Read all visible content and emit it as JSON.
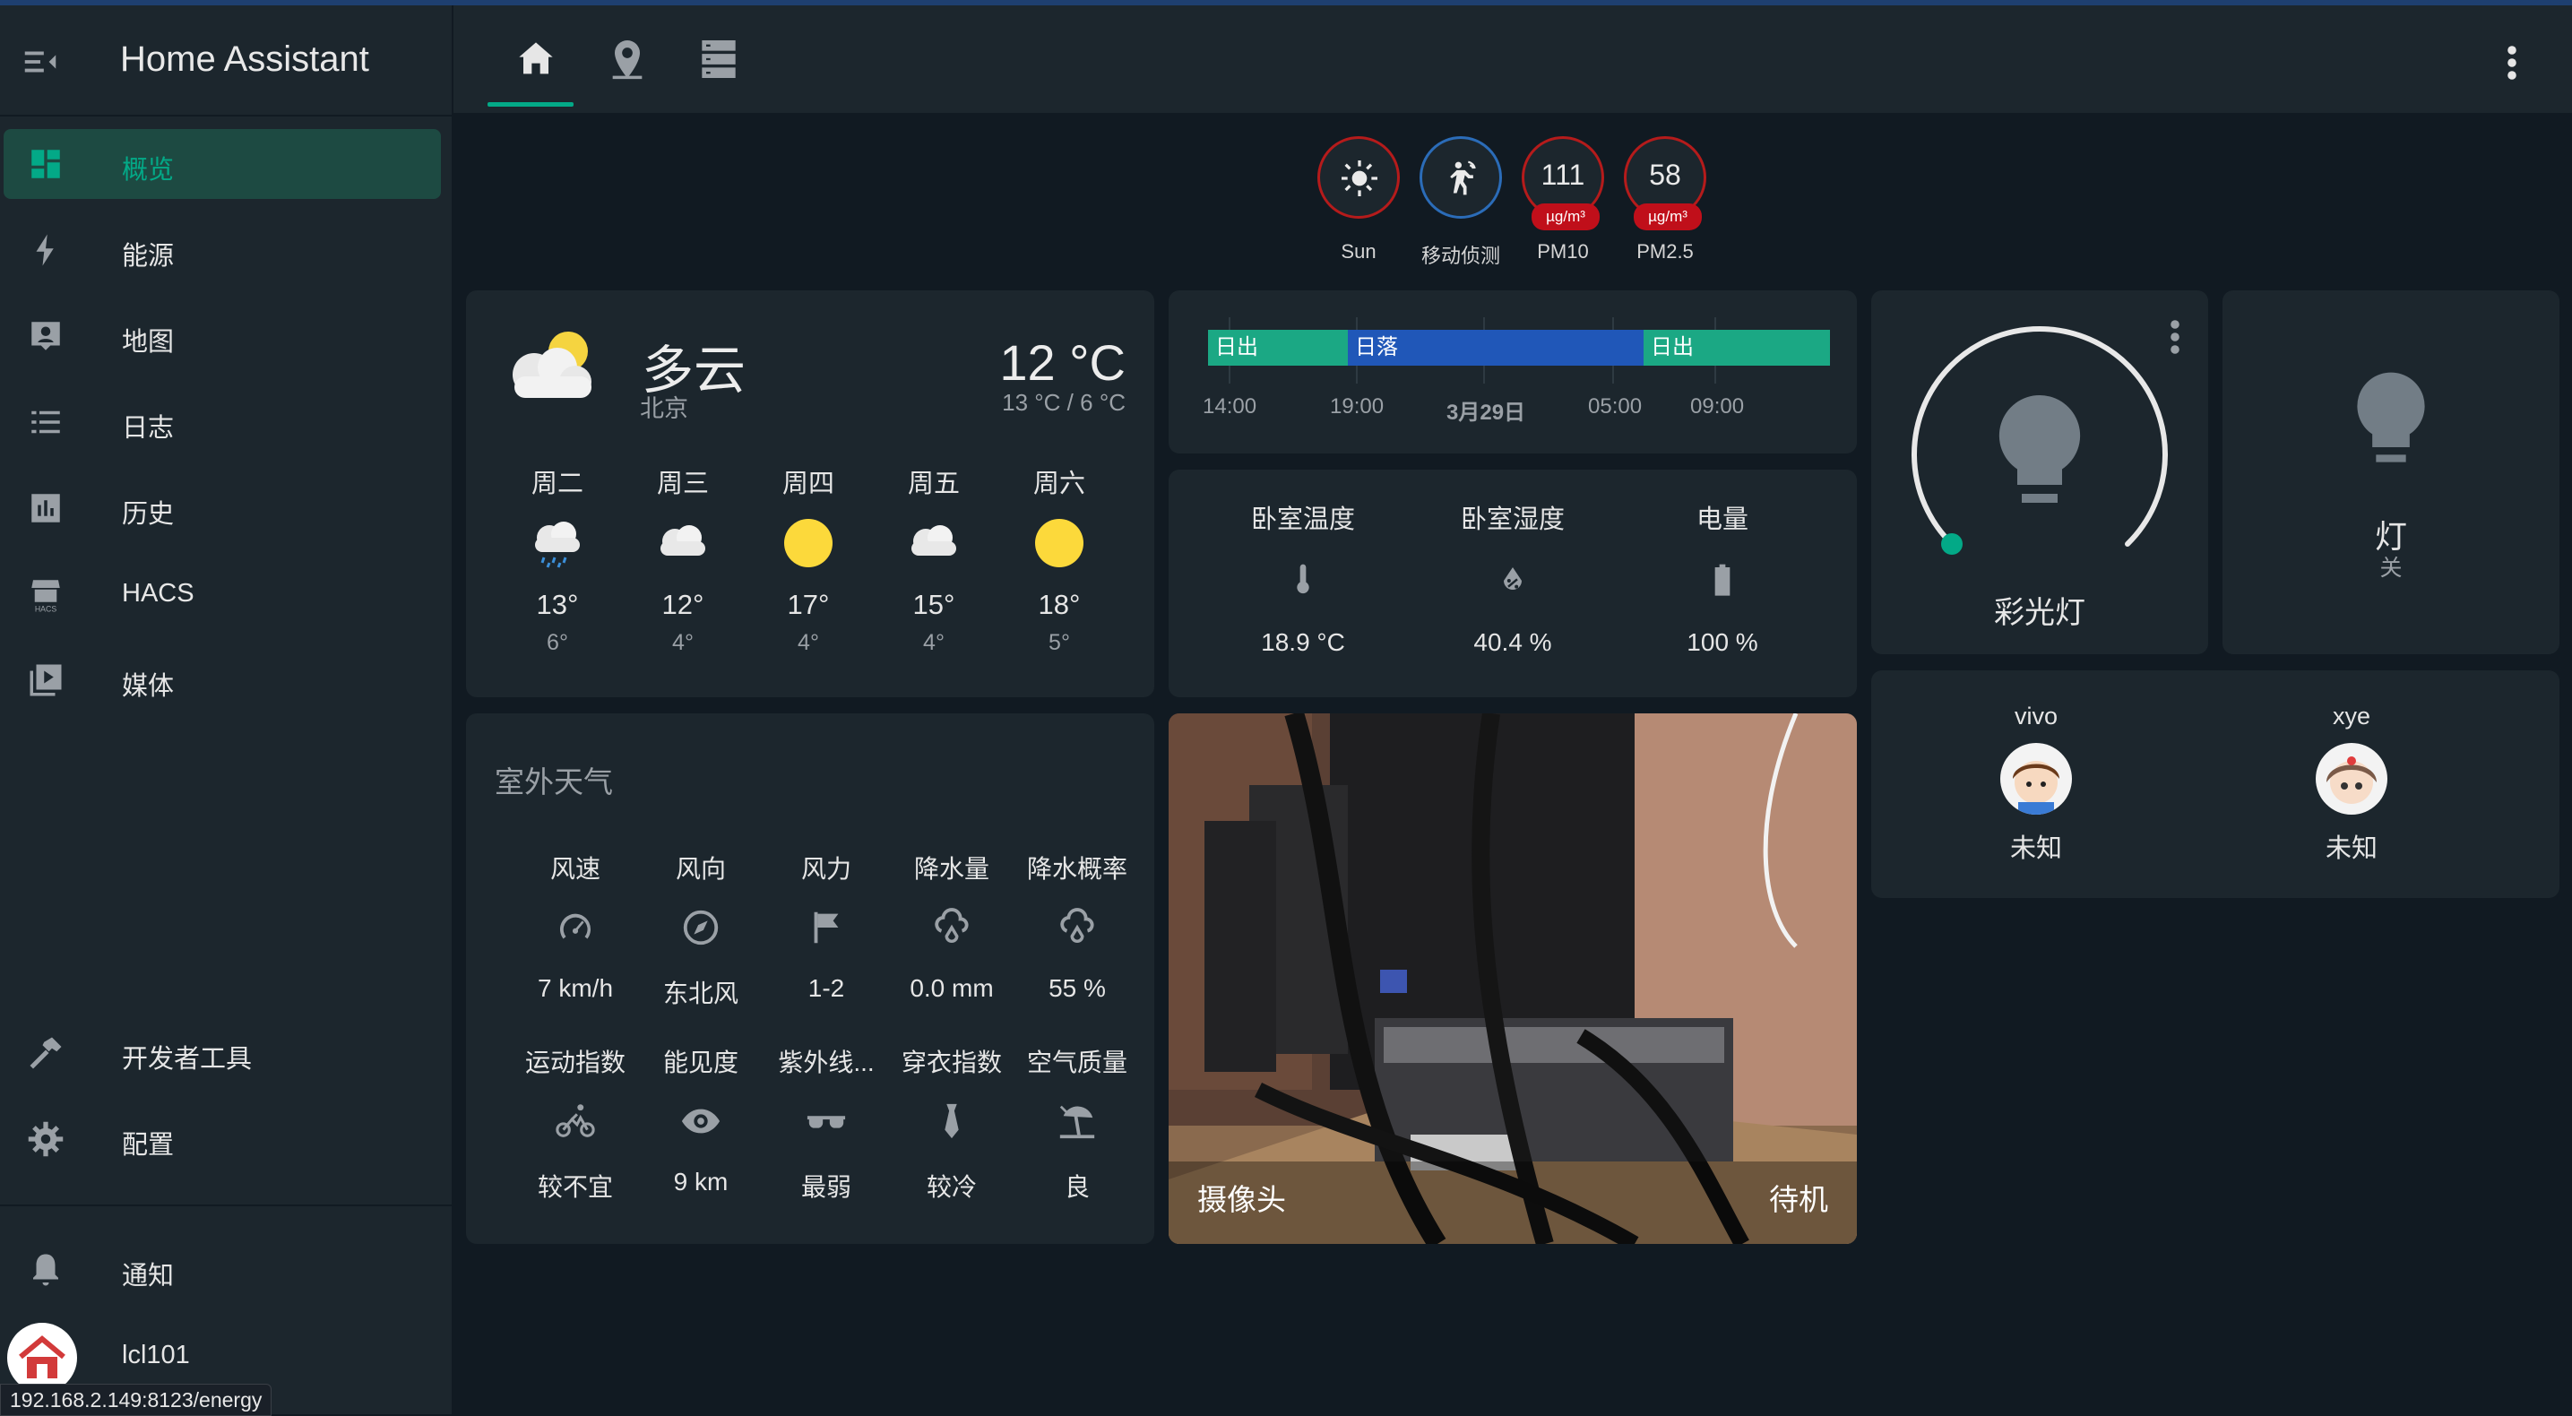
{
  "app": {
    "title": "Home Assistant"
  },
  "sidebar": {
    "items": [
      {
        "label": "概览",
        "icon": "dashboard-icon"
      },
      {
        "label": "能源",
        "icon": "lightning-icon"
      },
      {
        "label": "地图",
        "icon": "map-account-icon"
      },
      {
        "label": "日志",
        "icon": "list-icon"
      },
      {
        "label": "历史",
        "icon": "chart-box-icon"
      },
      {
        "label": "HACS",
        "icon": "hacs-icon"
      },
      {
        "label": "媒体",
        "icon": "play-box-icon"
      }
    ],
    "dev_tools": "开发者工具",
    "config": "配置",
    "notifications": "通知",
    "user": "lcl101"
  },
  "status_url": "192.168.2.149:8123/energy",
  "tabs": [
    {
      "icon": "home-icon"
    },
    {
      "icon": "map-marker-icon"
    },
    {
      "icon": "server-icon"
    }
  ],
  "badges": [
    {
      "label": "Sun",
      "icon": "sun-icon"
    },
    {
      "label": "移动侦测",
      "icon": "motion-sensor-icon"
    },
    {
      "label": "PM10",
      "value": "111",
      "unit": "µg/m³"
    },
    {
      "label": "PM2.5",
      "value": "58",
      "unit": "µg/m³"
    }
  ],
  "weather": {
    "condition": "多云",
    "city": "北京",
    "temperature": "12 °C",
    "range": "13 °C / 6 °C",
    "forecast": [
      {
        "day": "周二",
        "icon": "rainy-icon",
        "high": "13°",
        "low": "6°"
      },
      {
        "day": "周三",
        "icon": "cloudy-icon",
        "high": "12°",
        "low": "4°"
      },
      {
        "day": "周四",
        "icon": "sunny-icon",
        "high": "17°",
        "low": "4°"
      },
      {
        "day": "周五",
        "icon": "cloudy-icon",
        "high": "15°",
        "low": "4°"
      },
      {
        "day": "周六",
        "icon": "sunny-icon",
        "high": "18°",
        "low": "5°"
      }
    ]
  },
  "outdoor": {
    "title": "室外天气",
    "row1": [
      {
        "label": "风速",
        "value": "7 km/h",
        "icon": "speedometer-icon"
      },
      {
        "label": "风向",
        "value": "东北风",
        "icon": "compass-icon"
      },
      {
        "label": "风力",
        "value": "1-2",
        "icon": "flag-icon"
      },
      {
        "label": "降水量",
        "value": "0.0 mm",
        "icon": "water-drop-icon"
      },
      {
        "label": "降水概率",
        "value": "55 %",
        "icon": "water-drop-icon"
      }
    ],
    "row2": [
      {
        "label": "运动指数",
        "value": "较不宜",
        "icon": "bike-icon"
      },
      {
        "label": "能见度",
        "value": "9 km",
        "icon": "eye-icon"
      },
      {
        "label": "紫外线...",
        "value": "最弱",
        "icon": "sunglasses-icon"
      },
      {
        "label": "穿衣指数",
        "value": "较冷",
        "icon": "tie-icon"
      },
      {
        "label": "空气质量",
        "value": "良",
        "icon": "beach-umbrella-icon"
      }
    ]
  },
  "sun_timeline": {
    "segments": [
      {
        "label": "日出",
        "color": "#1ba884"
      },
      {
        "label": "日落",
        "color": "#2057b8"
      },
      {
        "label": "日出",
        "color": "#1ba884"
      }
    ],
    "ticks": [
      "14:00",
      "19:00",
      "3月29日",
      "05:00",
      "09:00"
    ]
  },
  "sensors": [
    {
      "label": "卧室温度",
      "value": "18.9 °C",
      "icon": "thermometer-icon"
    },
    {
      "label": "卧室湿度",
      "value": "40.4 %",
      "icon": "water-percent-icon"
    },
    {
      "label": "电量",
      "value": "100 %",
      "icon": "battery-icon"
    }
  ],
  "camera": {
    "name": "摄像头",
    "state": "待机"
  },
  "light": {
    "name": "彩光灯"
  },
  "lamp": {
    "name": "灯",
    "state": "关"
  },
  "people": [
    {
      "name": "vivo",
      "state": "未知"
    },
    {
      "name": "xye",
      "state": "未知"
    }
  ],
  "colors": {
    "accent": "#03a987",
    "card": "#1c262d",
    "background": "#111a22",
    "alert": "#c00f1a"
  }
}
